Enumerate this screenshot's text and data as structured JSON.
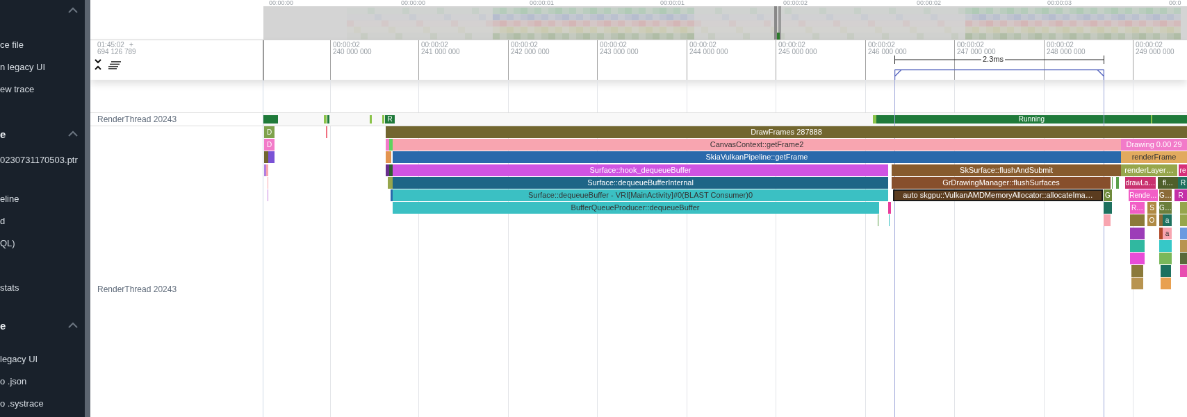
{
  "sidebar": {
    "sections": [
      {
        "expanded": true,
        "items": [
          "ce file",
          "n legacy UI",
          "ew trace"
        ]
      },
      {
        "title": "e",
        "expanded": true,
        "items": [
          "0230731170503.ptr",
          "eline",
          "d",
          "QL)",
          "stats"
        ]
      },
      {
        "title": "e",
        "expanded": true,
        "items": [
          "legacy UI",
          "o .json",
          "o .systrace"
        ]
      }
    ]
  },
  "overview": {
    "ticks": [
      "00:00:00",
      "00:00:00",
      "00:00:01",
      "00:00:01",
      "00:00:02",
      "00:00:02",
      "00:00:03",
      "00:0"
    ]
  },
  "ruler": {
    "origin_time": "01:45:02",
    "origin_plus": "+",
    "origin_ns": "694 126 789",
    "ticks": [
      {
        "time": "00:00:02",
        "ns": "240 000 000"
      },
      {
        "time": "00:00:02",
        "ns": "241 000 000"
      },
      {
        "time": "00:00:02",
        "ns": "242 000 000"
      },
      {
        "time": "00:00:02",
        "ns": "243 000 000"
      },
      {
        "time": "00:00:02",
        "ns": "244 000 000"
      },
      {
        "time": "00:00:02",
        "ns": "245 000 000"
      },
      {
        "time": "00:00:02",
        "ns": "246 000 000"
      },
      {
        "time": "00:00:02",
        "ns": "247 000 000"
      },
      {
        "time": "00:00:02",
        "ns": "248 000 000"
      },
      {
        "time": "00:00:02",
        "ns": "249 000 000"
      }
    ],
    "measurement": "2.3ms"
  },
  "thread_track": {
    "name": "RenderThread 20243",
    "states": [
      {
        "label": "R"
      },
      {
        "label": "Running"
      }
    ]
  },
  "slice_track": {
    "name": "RenderThread 20243",
    "slices": [
      {
        "label": "DrawFrames 287888",
        "color": "#72662f",
        "selected": false
      },
      {
        "label": "CanvasContext::getFrame2",
        "color": "#f8a5b0",
        "selected": false
      },
      {
        "label": "Drawing 0.00 29",
        "color": "#f27bc9",
        "selected": false
      },
      {
        "label": "SkiaVulkanPipeline::getFrame",
        "color": "#2a69ab",
        "selected": false
      },
      {
        "label": "renderFrame",
        "color": "#e2aa5e",
        "selected": false
      },
      {
        "label": "Surface::hook_dequeueBuffer",
        "color": "#d054e2",
        "selected": false
      },
      {
        "label": "SkSurface::flushAndSubmit",
        "color": "#875b2e",
        "selected": false
      },
      {
        "label": "renderLayer…",
        "color": "#96a64c",
        "selected": false
      },
      {
        "label": "re",
        "color": "#d6307a",
        "selected": false
      },
      {
        "label": "Surface::dequeueBufferInternal",
        "color": "#1e6687",
        "selected": false
      },
      {
        "label": "GrDrawingManager::flushSurfaces",
        "color": "#874f2c",
        "selected": false
      },
      {
        "label": "drawLa…",
        "color": "#c9316f",
        "selected": false
      },
      {
        "label": "fl…",
        "color": "#4f5f2b",
        "selected": false
      },
      {
        "label": "R",
        "color": "#1e715f",
        "selected": false
      },
      {
        "label": "Surface::dequeueBuffer - VRI[MainActivity]#0(BLAST Consumer)0",
        "color": "#3bc0c3",
        "selected": false
      },
      {
        "label": "auto skgpu::VulkanAMDMemoryAllocator::allocateIma…",
        "color": "#5b3c1f",
        "selected": true
      },
      {
        "label": "G",
        "color": "#6e8a3b",
        "selected": false
      },
      {
        "label": "Rende…",
        "color": "#f25ec6",
        "selected": false
      },
      {
        "label": "G…",
        "color": "#8b6a37",
        "selected": false
      },
      {
        "label": "R",
        "color": "#c42fa8",
        "selected": false
      },
      {
        "label": "BufferQueueProducer::dequeueBuffer",
        "color": "#3bc0c3",
        "selected": false
      },
      {
        "label": "R…",
        "color": "#f25ec6",
        "selected": false
      },
      {
        "label": "S",
        "color": "#b08a44",
        "selected": false
      },
      {
        "label": "G…",
        "color": "#6b7f3c",
        "selected": false
      },
      {
        "label": "O",
        "color": "#b08a44",
        "selected": false
      },
      {
        "label": "a",
        "color": "#1e715f",
        "selected": false
      },
      {
        "label": "a",
        "color": "#f8a5b0",
        "selected": false
      },
      {
        "label": "D",
        "color": "#7fa24c",
        "selected": false
      },
      {
        "label": "D",
        "color": "#f27bc9",
        "selected": false
      }
    ]
  }
}
